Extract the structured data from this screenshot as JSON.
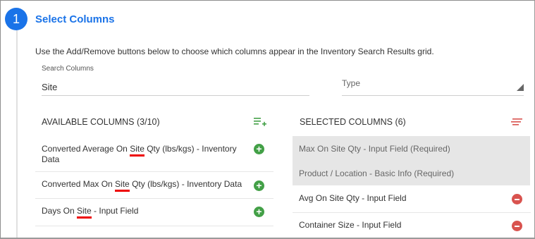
{
  "step": {
    "number": "1",
    "title": "Select Columns"
  },
  "description": "Use the Add/Remove buttons below to choose which columns appear in the Inventory Search Results grid.",
  "search": {
    "label": "Search Columns",
    "value": "Site"
  },
  "type_select": {
    "placeholder": "Type"
  },
  "available": {
    "heading": "AVAILABLE COLUMNS (3/10)",
    "items": [
      {
        "pre": "Converted Average On ",
        "match": "Site",
        "post": " Qty (lbs/kgs) - Inventory",
        "line2": "Data"
      },
      {
        "pre": "Converted Max On ",
        "match": "Site",
        "post": " Qty (lbs/kgs) - Inventory Data",
        "line2": ""
      },
      {
        "pre": "Days On ",
        "match": "Site",
        "post": " - Input Field",
        "line2": ""
      }
    ]
  },
  "selected": {
    "heading": "SELECTED COLUMNS (6)",
    "required": [
      "Max On Site Qty - Input Field (Required)",
      "Product / Location - Basic Info (Required)"
    ],
    "items": [
      "Avg On Site Qty - Input Field",
      "Container Size - Input Field"
    ]
  },
  "colors": {
    "accent": "#1a73e8",
    "add": "#43a047",
    "remove": "#d9534f",
    "highlight": "#e00000"
  }
}
